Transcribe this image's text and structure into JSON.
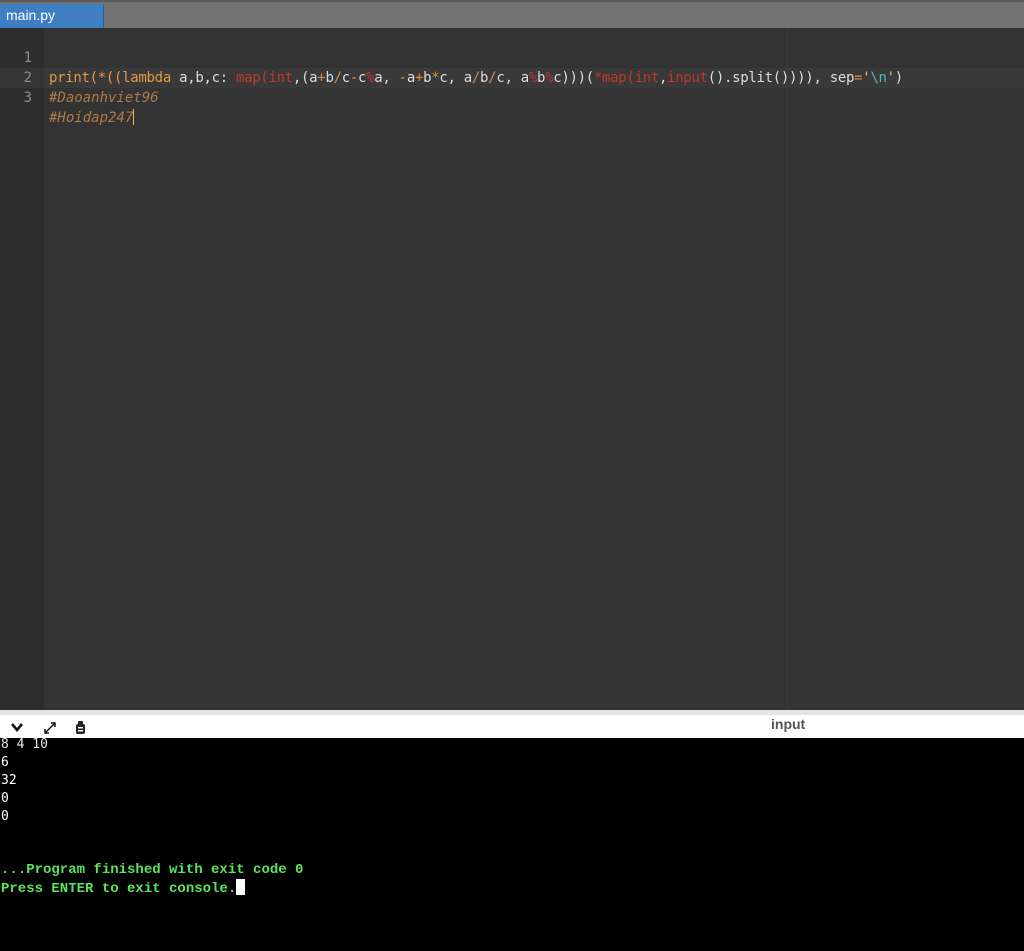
{
  "tabs": [
    {
      "label": "main.py",
      "active": true
    }
  ],
  "editor": {
    "lines": [
      {
        "number": "1"
      },
      {
        "number": "2",
        "text": "#Daoanhviet96"
      },
      {
        "number": "3",
        "text": "#Hoidap247"
      }
    ],
    "line1_tokens": {
      "t1": "print",
      "t2": "(*((",
      "t3": "lambda",
      "t4": " a,b,c: ",
      "t5": "map",
      "t6": "(",
      "t7": "int",
      "t8": ",(a",
      "t9": "+",
      "t10": "b",
      "t11": "/",
      "t12": "c",
      "t13": "-",
      "t14": "c",
      "t15": "%",
      "t16": "a, ",
      "t17": "-",
      "t18": "a",
      "t19": "+",
      "t20": "b",
      "t21": "*",
      "t22": "c, a",
      "t23": "/",
      "t24": "b",
      "t25": "/",
      "t26": "c, a",
      "t27": "%",
      "t28": "b",
      "t29": "%",
      "t30": "c)))(",
      "t31": "*map(",
      "t32": "int",
      "t33": ",",
      "t34": "input",
      "t35": "().split())))",
      "t36": ", sep",
      "t37": "=",
      "t38": "'",
      "t39": "\\n",
      "t40": "'",
      "t41": ")"
    }
  },
  "console_toolbar": {
    "icons": [
      "chevron-down-icon",
      "expand-icon",
      "debug-icon"
    ],
    "input_label": "input"
  },
  "console": {
    "input_line": "8 4 10",
    "outputs": [
      "6",
      "32",
      "0",
      "0"
    ],
    "finish_message": "...Program finished with exit code 0",
    "exit_prompt": "Press ENTER to exit console."
  },
  "colors": {
    "tab_active": "#3d7fc1",
    "editor_bg": "#333333",
    "console_bg": "#000000",
    "console_message": "#5ce35c"
  }
}
